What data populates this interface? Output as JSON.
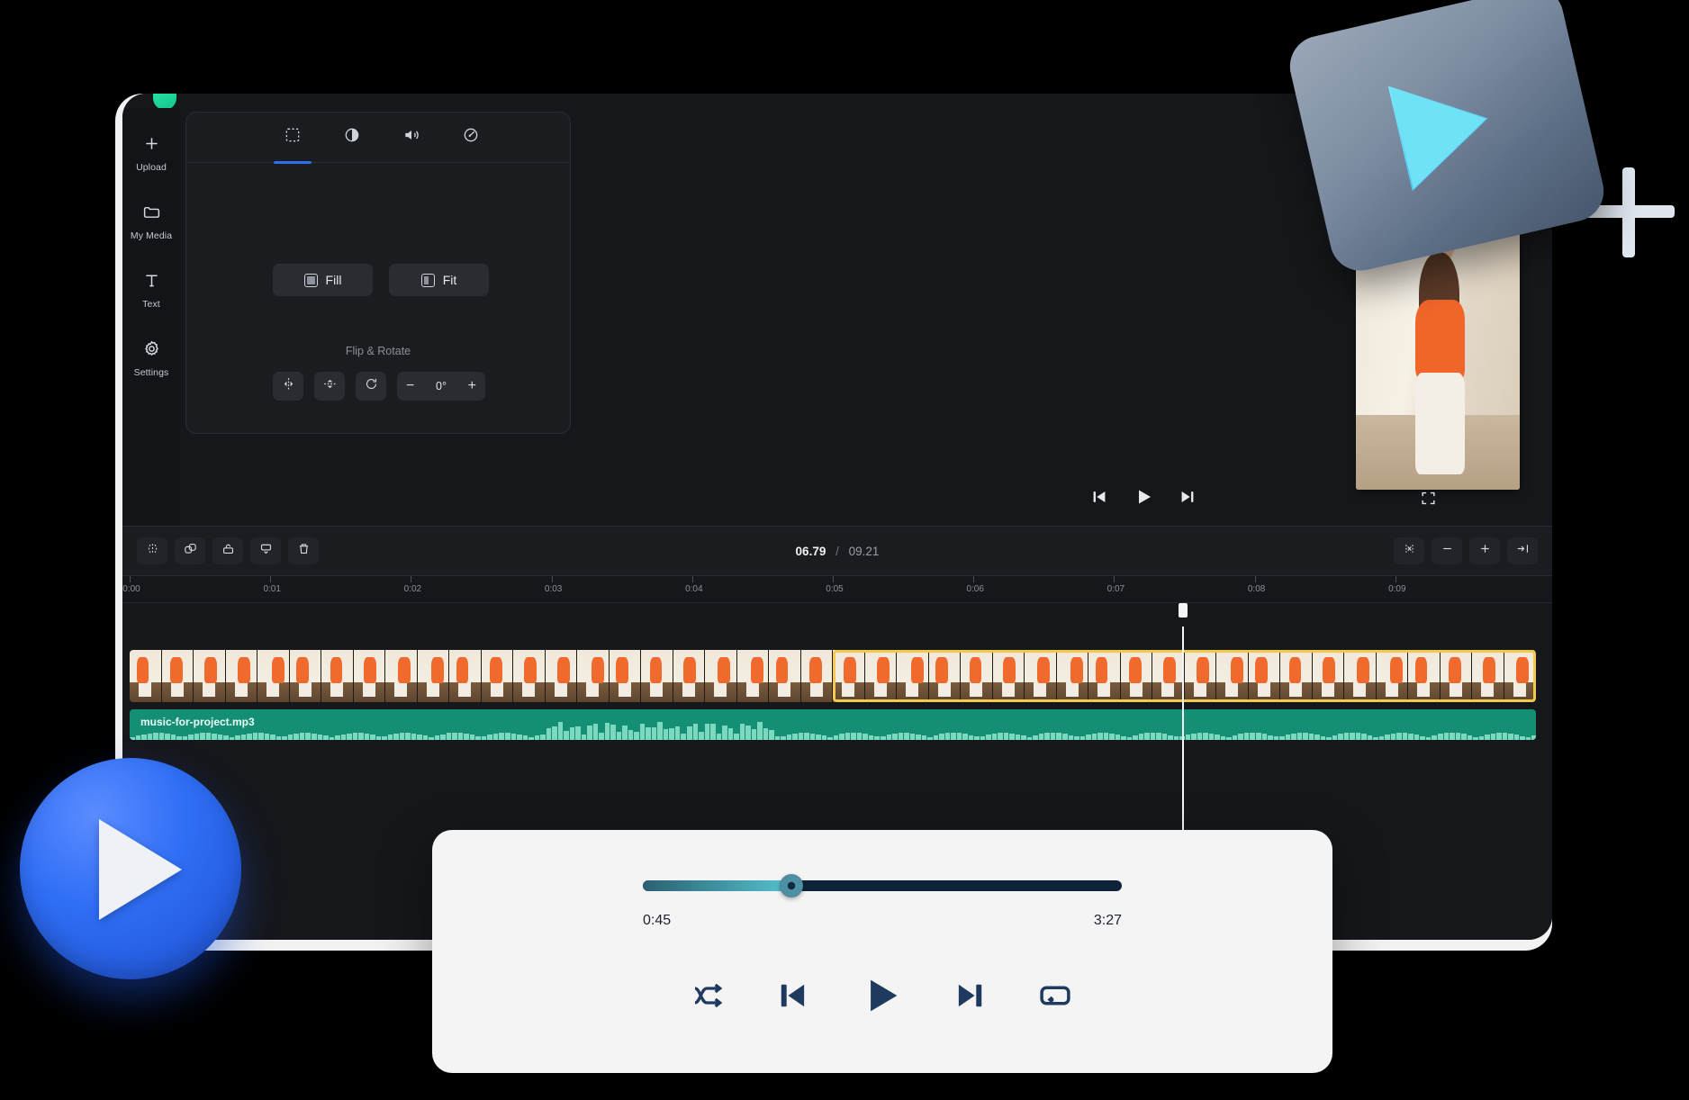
{
  "app": {
    "brand_color": "#21d6a0",
    "accent_color": "#2f6fed",
    "rail": {
      "items": [
        {
          "label": "Upload",
          "icon": "plus-icon"
        },
        {
          "label": "My Media",
          "icon": "folder-icon"
        },
        {
          "label": "Text",
          "icon": "text-icon"
        },
        {
          "label": "Settings",
          "icon": "gear-icon"
        }
      ]
    }
  },
  "properties_panel": {
    "tabs": [
      {
        "name": "transform",
        "icon": "transform-icon",
        "active": true
      },
      {
        "name": "adjust",
        "icon": "contrast-icon",
        "active": false
      },
      {
        "name": "audio",
        "icon": "volume-icon",
        "active": false
      },
      {
        "name": "speed",
        "icon": "speed-icon",
        "active": false
      }
    ],
    "fill_label": "Fill",
    "fit_label": "Fit",
    "section_title": "Flip & Rotate",
    "flip_horizontal_icon": "flip-horizontal-icon",
    "flip_vertical_icon": "flip-vertical-icon",
    "rotate_icon": "rotate-cw-icon",
    "rotation_value": "0°",
    "decrement_label": "−",
    "increment_label": "+"
  },
  "preview": {
    "prev_icon": "skip-back-icon",
    "play_icon": "play-icon",
    "next_icon": "skip-forward-icon",
    "fullscreen_icon": "fullscreen-icon"
  },
  "timeline_toolbar": {
    "tools": [
      {
        "name": "split",
        "icon": "split-icon"
      },
      {
        "name": "duplicate",
        "icon": "duplicate-icon"
      },
      {
        "name": "crop",
        "icon": "crop-icon"
      },
      {
        "name": "caption",
        "icon": "caption-icon"
      },
      {
        "name": "delete",
        "icon": "trash-icon"
      }
    ],
    "current_time": "06.79",
    "separator": "/",
    "total_time": "09.21",
    "right_tools": [
      {
        "name": "fit-timeline",
        "icon": "fit-timeline-icon",
        "label": ""
      },
      {
        "name": "zoom-out",
        "icon": "minus-icon",
        "label": "−"
      },
      {
        "name": "zoom-in",
        "icon": "plus-icon",
        "label": "+"
      },
      {
        "name": "collapse",
        "icon": "collapse-icon",
        "label": ""
      }
    ]
  },
  "timeline": {
    "ruler_ticks": [
      "0:00",
      "0:01",
      "0:02",
      "0:03",
      "0:04",
      "0:05",
      "0:06",
      "0:07",
      "0:08",
      "0:09"
    ],
    "playhead_position_pct": 73.6,
    "video_clip": {
      "name": "video-clip",
      "frame_count": 44,
      "selected_from_index": 22,
      "selection_color": "#f2c94c"
    },
    "audio_clip": {
      "label": "music-for-project.mp3",
      "color": "#158f74"
    }
  },
  "media_player": {
    "progress_pct": 31,
    "elapsed": "0:45",
    "duration": "3:27",
    "controls": [
      {
        "name": "shuffle",
        "icon": "shuffle-icon"
      },
      {
        "name": "previous",
        "icon": "skip-back-icon"
      },
      {
        "name": "play",
        "icon": "play-icon"
      },
      {
        "name": "next",
        "icon": "skip-forward-icon"
      },
      {
        "name": "repeat",
        "icon": "repeat-icon"
      }
    ],
    "track_color": "#0e2338",
    "fill_color": "#55c3cf"
  },
  "decorations": {
    "play_badge_large": "play-badge-blue",
    "play_badge_card": "play-badge-card",
    "sparkle": "sparkle-icon"
  }
}
